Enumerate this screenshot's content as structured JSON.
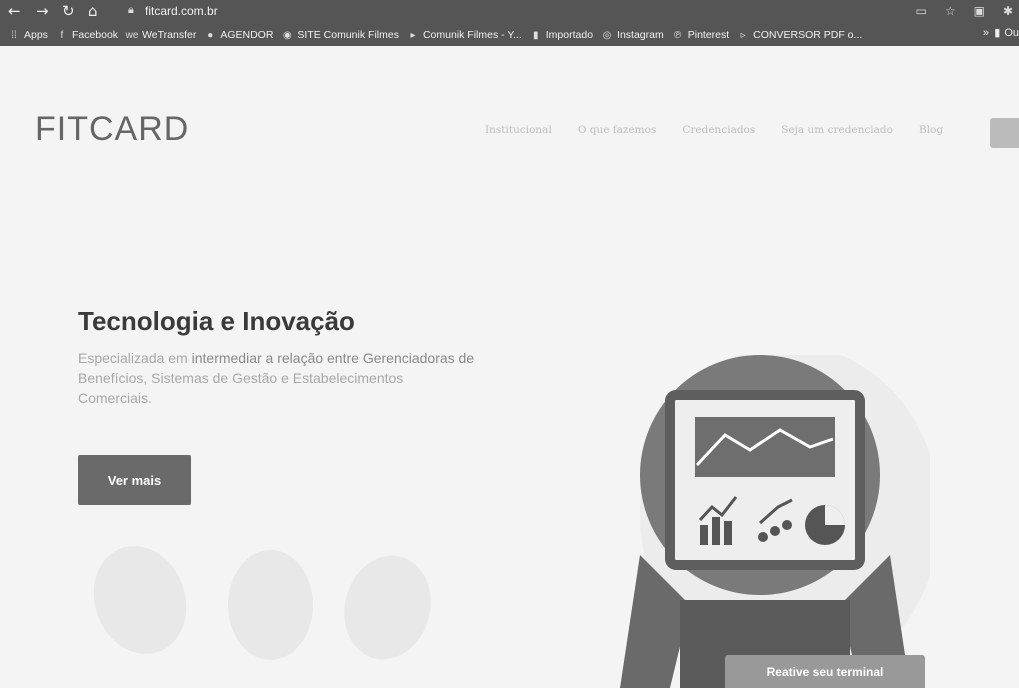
{
  "browser": {
    "url": "fitcard.com.br",
    "bookmarks": [
      {
        "label": "Apps",
        "icon": "apps-grid-icon"
      },
      {
        "label": "Facebook",
        "icon": "facebook-icon"
      },
      {
        "label": "WeTransfer",
        "icon": "wetransfer-icon"
      },
      {
        "label": "AGENDOR",
        "icon": "agendor-icon"
      },
      {
        "label": "SITE Comunik Filmes",
        "icon": "globe-icon"
      },
      {
        "label": "Comunik Filmes - Y...",
        "icon": "youtube-icon"
      },
      {
        "label": "Importado",
        "icon": "folder-icon"
      },
      {
        "label": "Instagram",
        "icon": "instagram-icon"
      },
      {
        "label": "Pinterest",
        "icon": "pinterest-icon"
      },
      {
        "label": "CONVERSOR PDF o...",
        "icon": "pdf-icon"
      }
    ],
    "overflow_label": "»",
    "last_bookmark": "Ou"
  },
  "site": {
    "logo": "FITCARD",
    "nav": [
      "Institucional",
      "O que fazemos",
      "Credenciados",
      "Seja um credenciado",
      "Blog"
    ],
    "hero": {
      "title": "Tecnologia e Inovação",
      "subtitle_part1": "Especializada em ",
      "subtitle_part2": "intermediar a relação entre Gerenciadoras de",
      "subtitle_line2": "Benefícios, Sistemas de Gestão e Estabelecimentos",
      "subtitle_line3": "Comerciais.",
      "button": "Ver mais"
    },
    "cta": "Reative seu terminal"
  }
}
